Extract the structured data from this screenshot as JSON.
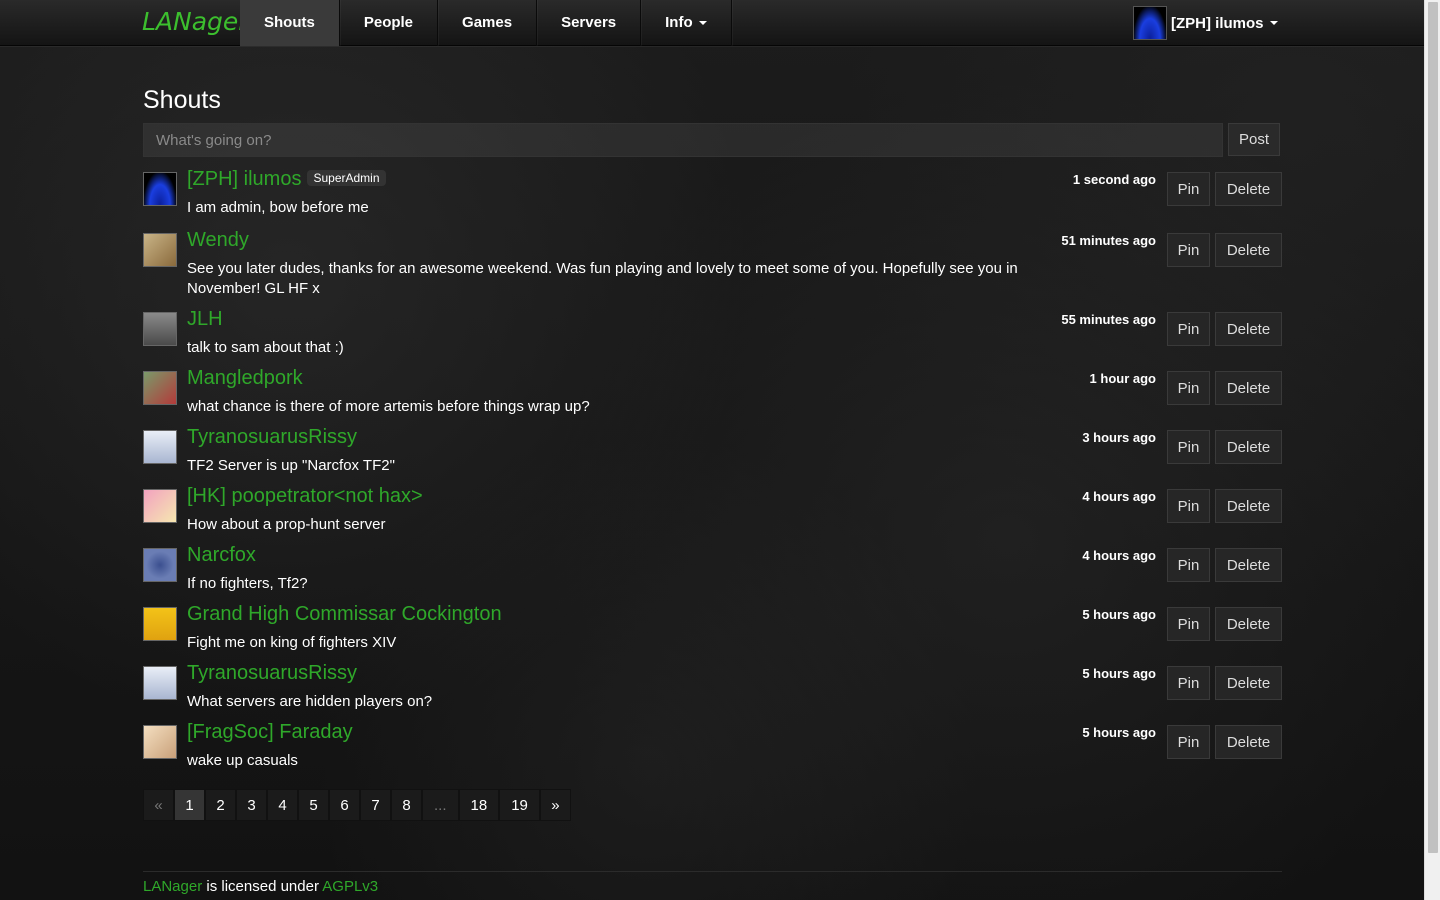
{
  "brand": "LANager",
  "nav": {
    "items": [
      {
        "label": "Shouts",
        "active": true
      },
      {
        "label": "People"
      },
      {
        "label": "Games"
      },
      {
        "label": "Servers"
      },
      {
        "label": "Info",
        "dropdown": true
      }
    ],
    "user": {
      "name": "[ZPH] ilumos",
      "icon": "user-avatar",
      "dropdown": true
    }
  },
  "page": {
    "title": "Shouts",
    "input_placeholder": "What's going on?",
    "post_label": "Post"
  },
  "shouts": [
    {
      "user": "[ZPH] ilumos",
      "badge": "SuperAdmin",
      "message": "I am admin, bow before me",
      "time": "1 second ago"
    },
    {
      "user": "Wendy",
      "message": "See you later dudes, thanks for an awesome weekend. Was fun playing and lovely to meet some of you. Hopefully see you in November! GL HF x",
      "time": "51 minutes ago"
    },
    {
      "user": "JLH",
      "message": "talk to sam about that :)",
      "time": "55 minutes ago"
    },
    {
      "user": "Mangledpork",
      "message": "what chance is there of more artemis before things wrap up?",
      "time": "1 hour ago"
    },
    {
      "user": "TyranosuarusRissy",
      "message": "TF2 Server is up \"Narcfox TF2\"",
      "time": "3 hours ago"
    },
    {
      "user": "[HK] poopetrator<not hax>",
      "message": "How about a prop-hunt server",
      "time": "4 hours ago"
    },
    {
      "user": "Narcfox",
      "message": "If no fighters, Tf2?",
      "time": "4 hours ago"
    },
    {
      "user": "Grand High Commissar Cockington",
      "message": "Fight me on king of fighters XIV",
      "time": "5 hours ago"
    },
    {
      "user": "TyranosuarusRissy",
      "message": "What servers are hidden players on?",
      "time": "5 hours ago"
    },
    {
      "user": "[FragSoc] Faraday",
      "message": "wake up casuals",
      "time": "5 hours ago"
    }
  ],
  "actions": {
    "pin_label": "Pin",
    "delete_label": "Delete"
  },
  "pagination": {
    "prev": "«",
    "pages": [
      "1",
      "2",
      "3",
      "4",
      "5",
      "6",
      "7",
      "8",
      "...",
      "18",
      "19"
    ],
    "current": "1",
    "next": "»"
  },
  "footer": {
    "app_link": "LANager",
    "text": " is licensed under ",
    "license_link": "AGPLv3"
  },
  "colors": {
    "accent": "#2fa82a",
    "background": "#151515",
    "navbar": "#1e1e1e"
  }
}
